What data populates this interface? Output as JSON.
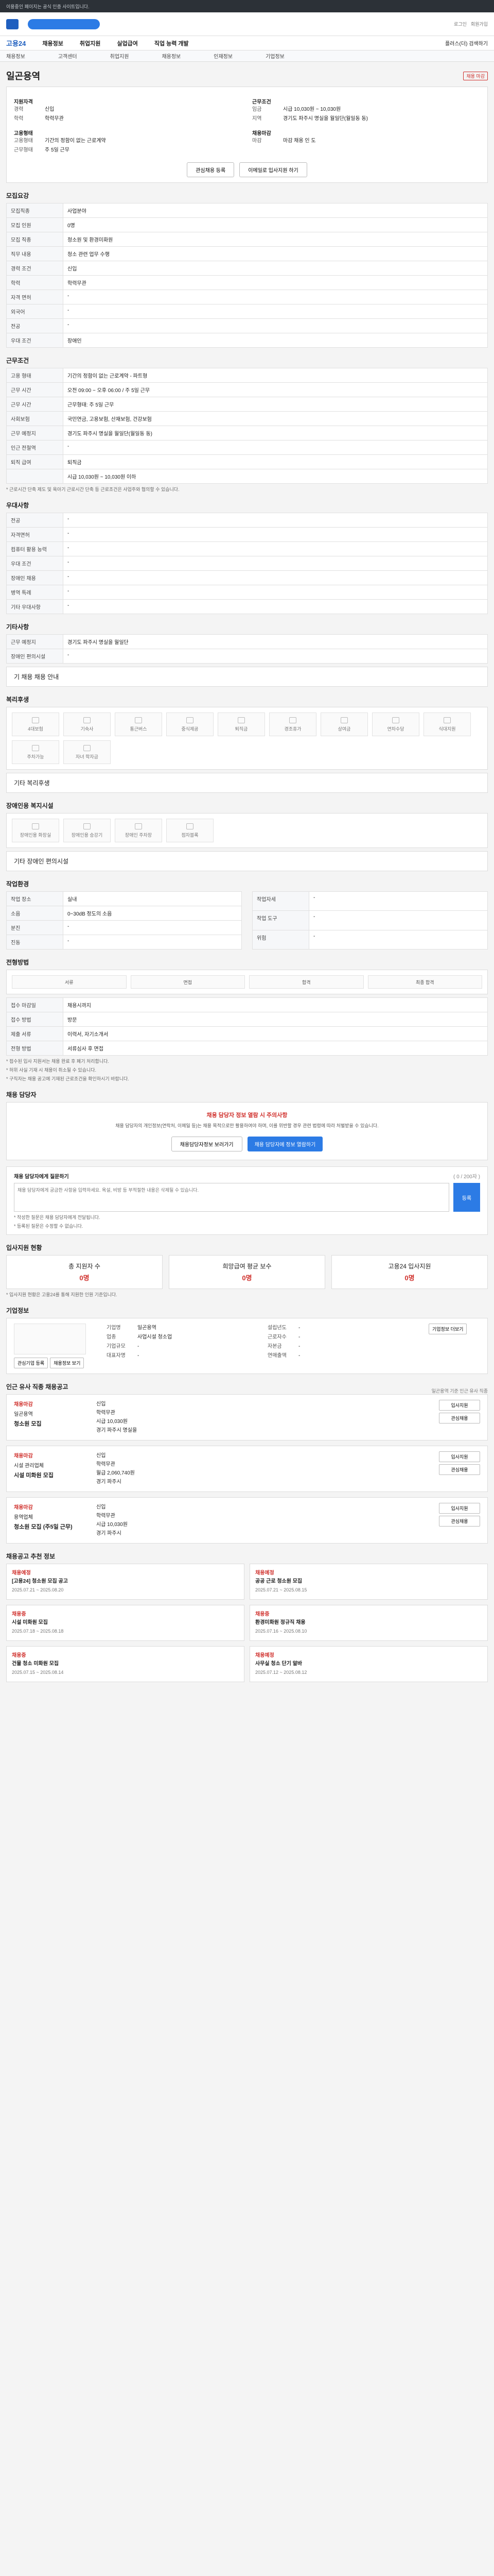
{
  "topbar": {
    "notice": "이용중인 페이지는 공식 인증 사이트입니다."
  },
  "header": {
    "right_links": [
      "로그인",
      "회원가입"
    ]
  },
  "gnb": {
    "brand": "고용24",
    "items": [
      "채용정보",
      "취업지원",
      "실업급여",
      "직업 능력 개발"
    ],
    "right": "플러스(더) 검색하기"
  },
  "lnb": {
    "items": [
      "채용정보",
      "고객센터",
      "취업지원",
      "채용정보",
      "인재정보",
      "기업정보"
    ]
  },
  "page": {
    "title": "일곤용역",
    "badge": "채용 마감"
  },
  "summary": {
    "left_head": "지원자격",
    "left": [
      [
        "경력",
        "신입"
      ],
      [
        "학력",
        "학력무관"
      ]
    ],
    "left2_head": "고용형태",
    "left2": [
      [
        "고용형태",
        "기간의 정함이 없는 근로계약"
      ],
      [
        "근무형태",
        "주 5일 근무"
      ]
    ],
    "right_head": "근무조건",
    "right": [
      [
        "임금",
        "시급 10,030원 ~ 10,030원"
      ],
      [
        "지역",
        "경기도 파주시 명실을 월일단(월일동 동)"
      ]
    ],
    "right2_head": "채용마감",
    "right2": [
      [
        "마감",
        "마감 채용 인 도"
      ]
    ],
    "buttons": [
      "관심채용 등록",
      "이메일로 입사지원 하기"
    ]
  },
  "apply_section": {
    "title": "모집요강",
    "rows": [
      [
        "모집직종",
        "사업분야"
      ],
      [
        "모집 인원",
        "0명"
      ],
      [
        "모집 직종",
        "청소원 및 환경미화원"
      ],
      [
        "직무 내용",
        "청소 관련 업무 수행"
      ],
      [
        "경력 조건",
        "신입"
      ],
      [
        "학력",
        "학력무관"
      ],
      [
        "자격 면허",
        "-"
      ],
      [
        "외국어",
        "-"
      ],
      [
        "전공",
        "-"
      ],
      [
        "우대 조건",
        "장애인"
      ]
    ]
  },
  "conditions": {
    "title": "근무조건",
    "rows": [
      [
        "고용 형태",
        "기간의 정함이 없는 근로계약 - 파트형"
      ],
      [
        "근무 시간",
        "오전 09:00 ~ 오후 06:00 / 주 5일 근무"
      ],
      [
        "근무 시간",
        "근무형태: 주 5일 근무"
      ],
      [
        "사회보험",
        "국민연금, 고용보험, 산재보험, 건강보험"
      ],
      [
        "근무 예정지",
        "경기도 파주시 명실을 월일단(월일동 동)"
      ],
      [
        "인근 전철역",
        "-"
      ],
      [
        "퇴직 급여",
        "퇴직금"
      ]
    ],
    "wage": "시급 10,030원 ~ 10,030원 이하",
    "note": "* 근로시간 단축 제도 및 육아기 근로시간 단축 등 근로조건은 사업주와 협의할 수 있습니다."
  },
  "welfare": {
    "title": "우대사항",
    "rows": [
      [
        "전공",
        "-"
      ],
      [
        "자격면허",
        "-"
      ],
      [
        "컴퓨터 활용 능력",
        "-"
      ],
      [
        "우대 조건",
        "-"
      ],
      [
        "장애인 채용",
        "-"
      ],
      [
        "병역 특례",
        "-"
      ],
      [
        "기타 우대사항",
        "-"
      ]
    ]
  },
  "other": {
    "title": "기타사항",
    "rows": [
      [
        "근무 예정지",
        "경기도 파주시 명실을 월일단"
      ],
      [
        "장애인 편의시설",
        "-"
      ]
    ],
    "extra": "기 채용 채용 안내"
  },
  "benefits": {
    "title": "복리후생",
    "tiles": [
      "4대보험",
      "기숙사",
      "통근버스",
      "중식제공",
      "퇴직금",
      "경조휴가",
      "상여금",
      "연차수당",
      "식대지원",
      "주차가능",
      "자녀 학자금"
    ],
    "etc": "기타 복리후생"
  },
  "disability": {
    "title": "장애인용 복지시설",
    "tiles": [
      "장애인용 화장실",
      "장애인용 승강기",
      "장애인 주차장",
      "점자블록"
    ],
    "etc": "기타 장애인 편의시설"
  },
  "company": {
    "title": "작업환경",
    "rows": [
      [
        "작업 장소",
        "실내"
      ],
      [
        "소음",
        "0~30dB 정도의 소음"
      ],
      [
        "분진",
        "-"
      ],
      [
        "진동",
        "-"
      ]
    ],
    "right_rows": [
      [
        "작업자세",
        "-"
      ],
      [
        "작업 도구",
        "-"
      ],
      [
        "위험",
        "-"
      ]
    ]
  },
  "process": {
    "title": "전형방법",
    "steps": [
      "서류",
      "면접",
      "합격",
      "최종 합격"
    ],
    "rows": [
      [
        "접수 마감일",
        "채용시까지"
      ],
      [
        "접수 방법",
        "방문"
      ],
      [
        "제출 서류",
        "이력서, 자기소개서"
      ],
      [
        "전형 방법",
        "서류심사 후 면접"
      ]
    ],
    "notes": [
      "* 접수된 입사 지원서는 채용 완료 후 폐기 처리합니다.",
      "* 허위 사실 기재 시 채용이 취소될 수 있습니다.",
      "* 구직자는 채용 공고에 기재된 근로조건을 확인하시기 바랍니다."
    ]
  },
  "contact": {
    "title": "채용 담당자",
    "alert_title": "채용 담당자 정보 열람 시 주의사항",
    "alert_desc": "채용 담당자의 개인정보(연락처, 이메일 등)는 채용 목적으로만 활용하여야 하며, 이를 위반할 경우 관련 법령에 따라 처벌받을 수 있습니다.",
    "buttons": [
      "채용담당자정보 보러가기",
      "채용 담당자에 정보 열람하기"
    ]
  },
  "inquiry": {
    "title": "채용 담당자에게 질문하기",
    "counter": "( 0 / 200자 )",
    "placeholder": "채용 담당자에게 궁금한 사항을 입력하세요. 욕설, 비방 등 부적절한 내용은 삭제될 수 있습니다.",
    "submit": "등록",
    "notes": [
      "* 작성한 질문은 채용 담당자에게 전달됩니다.",
      "* 등록된 질문은 수정할 수 없습니다."
    ]
  },
  "stats": {
    "title": "입사지원 현황",
    "items": [
      [
        "총 지원자 수",
        "0명"
      ],
      [
        "희망급여 평균 보수",
        "0명"
      ],
      [
        "고용24 입사지원",
        "0명"
      ]
    ],
    "note": "* 입사지원 현황은 고용24를 통해 지원한 인원 기준입니다."
  },
  "company_info": {
    "title": "기업정보",
    "rows": [
      [
        "기업명",
        "일곤용역"
      ],
      [
        "업종",
        "사업시설 청소업"
      ],
      [
        "기업규모",
        "-"
      ],
      [
        "대표자명",
        "-"
      ]
    ],
    "right_rows": [
      [
        "설립년도",
        "-"
      ],
      [
        "근로자수",
        "-"
      ],
      [
        "자본금",
        "-"
      ],
      [
        "연매출액",
        "-"
      ]
    ],
    "links": [
      "기업정보 더보기"
    ],
    "buttons": [
      "관심기업 등록",
      "채용정보 보기"
    ]
  },
  "similar": {
    "title": "인근 유사 직종 채용공고",
    "right": "일곤용역 기준 인근 유사 직종",
    "jobs": [
      {
        "tag": "채용마감",
        "company": "일곤용역",
        "title": "청소원 모집",
        "info": [
          "신입",
          "학력무관",
          "시급 10,030원",
          "경기 파주시 명실을"
        ],
        "buttons": [
          "입사지원",
          "관심채용"
        ]
      },
      {
        "tag": "채용마감",
        "company": "시설 관리업체",
        "title": "시설 미화원 모집",
        "info": [
          "신입",
          "학력무관",
          "월급 2,060,740원",
          "경기 파주시"
        ],
        "buttons": [
          "입사지원",
          "관심채용"
        ]
      },
      {
        "tag": "채용마감",
        "company": "용역업체",
        "title": "청소원 모집 (주5일 근무)",
        "info": [
          "신입",
          "학력무관",
          "시급 10,030원",
          "경기 파주시"
        ],
        "buttons": [
          "입사지원",
          "관심채용"
        ]
      }
    ]
  },
  "recommend": {
    "title": "채용공고 추천 정보",
    "items": [
      {
        "tag": "채용예정",
        "title": "[고용24] 청소원 모집 공고",
        "date": "2025.07.21 ~ 2025.08.20"
      },
      {
        "tag": "채용예정",
        "title": "공공 근로 청소원 모집",
        "date": "2025.07.21 ~ 2025.08.15"
      },
      {
        "tag": "채용중",
        "title": "시설 미화원 모집",
        "date": "2025.07.18 ~ 2025.08.18"
      },
      {
        "tag": "채용중",
        "title": "환경미화원 정규직 채용",
        "date": "2025.07.16 ~ 2025.08.10"
      },
      {
        "tag": "채용중",
        "title": "건물 청소 미화원 모집",
        "date": "2025.07.15 ~ 2025.08.14"
      },
      {
        "tag": "채용예정",
        "title": "사무실 청소 단기 알바",
        "date": "2025.07.12 ~ 2025.08.12"
      }
    ]
  }
}
